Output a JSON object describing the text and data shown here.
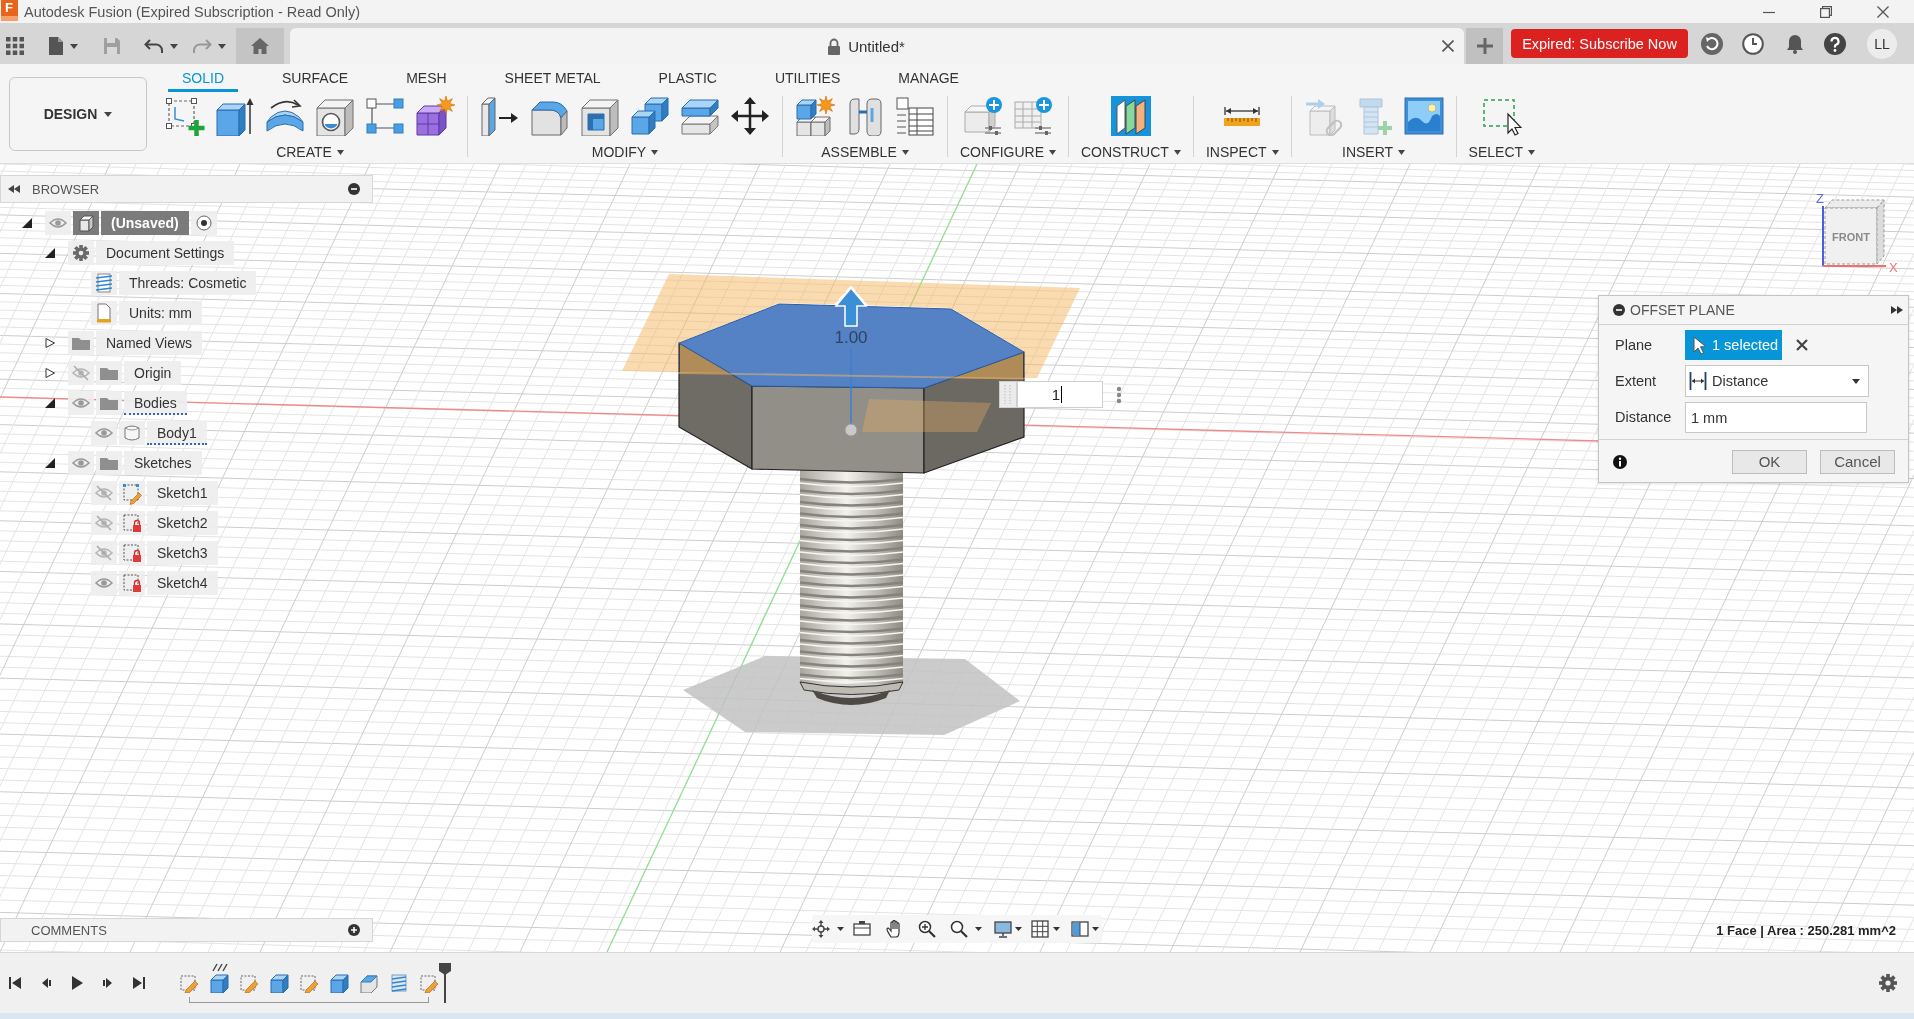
{
  "title_bar": {
    "logo_letter": "F",
    "title": "Autodesk Fusion (Expired Subscription - Read Only)"
  },
  "quick_access": [
    {
      "disabled": false
    },
    {
      "disabled": true
    },
    {
      "disabled": false
    },
    {
      "disabled": true
    }
  ],
  "document_tab": {
    "title": "Untitled*"
  },
  "account": {
    "subscribe_button": "Expired: Subscribe Now",
    "initials": "LL"
  },
  "toolbar": {
    "workspace": "DESIGN",
    "tabs": [
      {
        "label": "SOLID",
        "selected": true
      },
      {
        "label": "SURFACE",
        "selected": false
      },
      {
        "label": "MESH",
        "selected": false
      },
      {
        "label": "SHEET METAL",
        "selected": false
      },
      {
        "label": "PLASTIC",
        "selected": false
      },
      {
        "label": "UTILITIES",
        "selected": false
      },
      {
        "label": "MANAGE",
        "selected": false
      }
    ],
    "groups": [
      {
        "label": "CREATE",
        "tools": [
          {
            "disabled": false
          },
          {
            "disabled": false
          },
          {
            "disabled": false
          },
          {
            "disabled": false
          },
          {
            "disabled": false
          },
          {
            "disabled": false
          }
        ]
      },
      {
        "label": "MODIFY",
        "tools": [
          {
            "disabled": false
          },
          {
            "disabled": false
          },
          {
            "disabled": false
          },
          {
            "disabled": false
          },
          {
            "disabled": false
          },
          {
            "disabled": false
          }
        ]
      },
      {
        "label": "ASSEMBLE",
        "tools": [
          {
            "disabled": false
          },
          {
            "disabled": false
          },
          {
            "disabled": false
          }
        ]
      },
      {
        "label": "CONFIGURE",
        "tools": [
          {
            "disabled": false
          },
          {
            "disabled": false
          }
        ]
      },
      {
        "label": "CONSTRUCT",
        "tools": [
          {
            "disabled": false
          }
        ]
      },
      {
        "label": "INSPECT",
        "tools": [
          {
            "disabled": false
          }
        ]
      },
      {
        "label": "INSERT",
        "tools": [
          {
            "disabled": true
          },
          {
            "disabled": true
          },
          {
            "disabled": false
          }
        ]
      },
      {
        "label": "SELECT",
        "tools": [
          {
            "disabled": false
          }
        ]
      }
    ]
  },
  "browser": {
    "title": "BROWSER",
    "tree": [
      {
        "kind": "component",
        "label": "(Unsaved)",
        "expanded": true,
        "visible": true,
        "highlighted": false,
        "children": [
          {
            "kind": "settings",
            "label": "Document Settings",
            "expanded": true,
            "highlighted": false,
            "children": [
              {
                "kind": "thread_setting",
                "label": "Threads: Cosmetic",
                "highlighted": false
              },
              {
                "kind": "unit_setting",
                "label": "Units: mm",
                "highlighted": false
              }
            ]
          },
          {
            "kind": "folder",
            "label": "Named Views",
            "expanded": false,
            "highlighted": false
          },
          {
            "kind": "folder",
            "label": "Origin",
            "expanded": false,
            "visible": false,
            "highlighted": false
          },
          {
            "kind": "folder",
            "label": "Bodies",
            "expanded": true,
            "visible": true,
            "highlighted": true,
            "children": [
              {
                "kind": "body",
                "label": "Body1",
                "visible": true,
                "highlighted": true
              }
            ]
          },
          {
            "kind": "folder",
            "label": "Sketches",
            "expanded": true,
            "visible": true,
            "highlighted": false,
            "children": [
              {
                "kind": "sketch",
                "label": "Sketch1",
                "visible": false,
                "locked": false,
                "highlighted": false
              },
              {
                "kind": "sketch",
                "label": "Sketch2",
                "visible": false,
                "locked": true,
                "highlighted": false
              },
              {
                "kind": "sketch",
                "label": "Sketch3",
                "visible": false,
                "locked": true,
                "highlighted": false
              },
              {
                "kind": "sketch",
                "label": "Sketch4",
                "visible": true,
                "locked": true,
                "highlighted": false
              }
            ]
          }
        ]
      }
    ]
  },
  "viewport": {
    "dimension_label": "1.00",
    "dimension_input": "1",
    "view_cube": {
      "face": "FRONT",
      "axis_labels": [
        "Z",
        "X"
      ]
    }
  },
  "dialog": {
    "title": "OFFSET PLANE",
    "rows": [
      {
        "kind": "selection",
        "label": "Plane",
        "value": "1 selected"
      },
      {
        "kind": "dropdown",
        "label": "Extent",
        "value": "Distance"
      },
      {
        "kind": "input",
        "label": "Distance",
        "value": "1 mm"
      }
    ],
    "buttons": [
      "OK",
      "Cancel"
    ]
  },
  "comments": {
    "title": "COMMENTS"
  },
  "status": "1 Face | Area : 250.281 mm^2",
  "timeline": {
    "features": [
      {
        "kind": "sketch",
        "marked": false
      },
      {
        "kind": "extrude",
        "marked": true
      },
      {
        "kind": "sketch",
        "marked": false
      },
      {
        "kind": "extrude",
        "marked": false
      },
      {
        "kind": "sketch",
        "marked": false
      },
      {
        "kind": "extrude",
        "marked": false
      },
      {
        "kind": "chamfer",
        "marked": false
      },
      {
        "kind": "thread",
        "marked": false
      },
      {
        "kind": "sketch",
        "marked": false
      }
    ]
  }
}
